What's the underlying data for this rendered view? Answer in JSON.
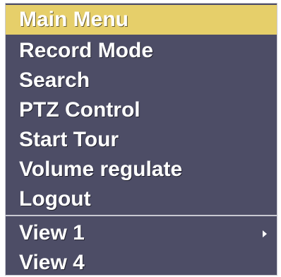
{
  "menu": {
    "items": [
      {
        "label": "Main Menu"
      },
      {
        "label": "Record Mode"
      },
      {
        "label": "Search"
      },
      {
        "label": "PTZ Control"
      },
      {
        "label": "Start Tour"
      },
      {
        "label": "Volume regulate"
      },
      {
        "label": "Logout"
      }
    ],
    "view_items": [
      {
        "label": "View 1",
        "submenu_icon": "chevron-right-icon"
      },
      {
        "label": "View 4"
      }
    ]
  },
  "colors": {
    "menu_background": "#4d4d66",
    "selected_highlight": "#e6cf6a",
    "text": "#ffffff",
    "divider": "#c9c9d2"
  }
}
